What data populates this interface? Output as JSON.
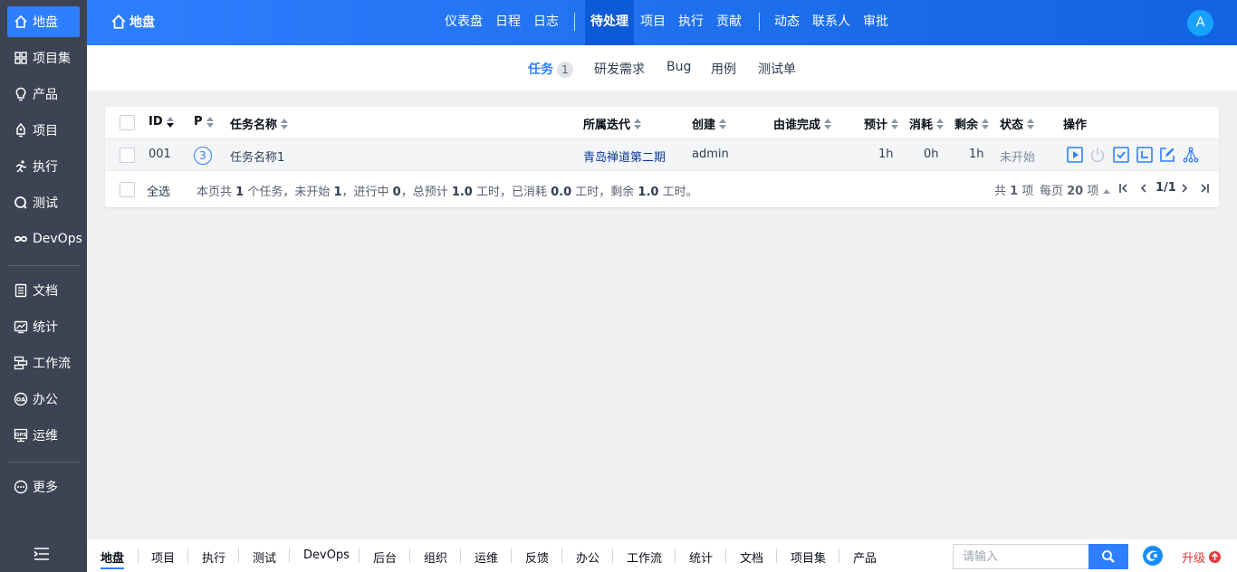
{
  "sidebar": {
    "items": [
      {
        "label": "地盘",
        "icon": "home-icon"
      },
      {
        "label": "项目集",
        "icon": "grid-icon"
      },
      {
        "label": "产品",
        "icon": "lightbulb-icon"
      },
      {
        "label": "项目",
        "icon": "project-icon"
      },
      {
        "label": "执行",
        "icon": "run-icon"
      },
      {
        "label": "测试",
        "icon": "test-icon"
      },
      {
        "label": "DevOps",
        "icon": "infinity-icon"
      },
      {
        "label": "文档",
        "icon": "doc-icon"
      },
      {
        "label": "统计",
        "icon": "chart-icon"
      },
      {
        "label": "工作流",
        "icon": "workflow-icon"
      },
      {
        "label": "办公",
        "icon": "oa-icon"
      },
      {
        "label": "运维",
        "icon": "ops-icon"
      },
      {
        "label": "更多",
        "icon": "more-icon"
      }
    ]
  },
  "topbar": {
    "home_label": "地盘",
    "nav": [
      "仪表盘",
      "日程",
      "日志",
      "待处理",
      "项目",
      "执行",
      "贡献",
      "动态",
      "联系人",
      "审批"
    ],
    "active": "待处理",
    "avatar": "A"
  },
  "subnav": {
    "items": [
      "任务",
      "研发需求",
      "Bug",
      "用例",
      "测试单"
    ],
    "task_count": "1"
  },
  "table": {
    "headers": {
      "id": "ID",
      "pri": "P",
      "name": "任务名称",
      "execution": "所属迭代",
      "creator": "创建",
      "finisher": "由谁完成",
      "estimate": "预计",
      "consumed": "消耗",
      "left": "剩余",
      "status": "状态",
      "actions": "操作"
    },
    "rows": [
      {
        "id": "001",
        "pri": "3",
        "name": "任务名称1",
        "execution": "青岛禅道第二期",
        "creator": "admin",
        "finisher": "",
        "estimate": "1h",
        "consumed": "0h",
        "left": "1h",
        "status": "未开始"
      }
    ],
    "select_all": "全选",
    "summary_parts": {
      "p1": "本页共 ",
      "total": "1",
      "p2": " 个任务，未开始 ",
      "wait": "1",
      "p3": "，进行中 ",
      "doing": "0",
      "p4": "，总预计 ",
      "est": "1.0",
      "p5": " 工时，已消耗 ",
      "cons": "0.0",
      "p6": " 工时，剩余 ",
      "left": "1.0",
      "p7": " 工时。"
    },
    "pager": {
      "total_pre": "共 ",
      "total": "1",
      "total_post": " 项",
      "per_pre": "每页 ",
      "per": "20",
      "per_post": " 项",
      "page": "1/1"
    }
  },
  "bottombar": {
    "items": [
      "地盘",
      "项目",
      "执行",
      "测试",
      "DevOps",
      "后台",
      "组织",
      "运维",
      "反馈",
      "办公",
      "工作流",
      "统计",
      "文档",
      "项目集",
      "产品"
    ],
    "search_placeholder": "请输入",
    "upgrade": "升级"
  },
  "colors": {
    "accent": "#2e7fff",
    "sidebar_bg": "#3c4353",
    "upgrade": "#e13a3a"
  }
}
